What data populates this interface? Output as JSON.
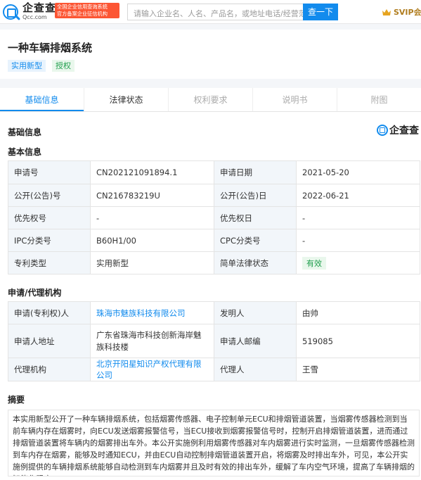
{
  "header": {
    "logo_cn": "企查查",
    "logo_en": "Qcc.com",
    "tagline_line1": "全国企业信用查询系统",
    "tagline_line2": "官方备案企业征信机构",
    "search_placeholder": "请输入企业名、人名、产品名，或地址电话/经营范",
    "search_button": "查一下",
    "svip_label": "SVIP会员"
  },
  "patent": {
    "title": "一种车辆排烟系统",
    "tags": [
      "实用新型",
      "授权"
    ]
  },
  "tabs": [
    "基础信息",
    "法律状态",
    "权利要求",
    "说明书",
    "附图"
  ],
  "section_title": "基础信息",
  "brand_logo_text": "企查查",
  "basic_info": {
    "subtitle": "基本信息",
    "rows": [
      {
        "l1": "申请号",
        "v1": "CN202121091894.1",
        "l2": "申请日期",
        "v2": "2021-05-20"
      },
      {
        "l1": "公开(公告)号",
        "v1": "CN216783219U",
        "l2": "公开(公告)日",
        "v2": "2022-06-21"
      },
      {
        "l1": "优先权号",
        "v1": "-",
        "l2": "优先权日",
        "v2": "-"
      },
      {
        "l1": "IPC分类号",
        "v1": "B60H1/00",
        "l2": "CPC分类号",
        "v2": "-"
      },
      {
        "l1": "专利类型",
        "v1": "实用新型",
        "l2": "简单法律状态",
        "v2": "有效"
      }
    ]
  },
  "agency": {
    "subtitle": "申请/代理机构",
    "rows": [
      {
        "l1": "申请(专利权)人",
        "v1": "珠海市魅族科技有限公司",
        "l2": "发明人",
        "v2": "由帅"
      },
      {
        "l1": "申请人地址",
        "v1": "广东省珠海市科技创新海岸魅族科技楼",
        "l2": "申请人邮编",
        "v2": "519085"
      },
      {
        "l1": "代理机构",
        "v1": "北京开阳星知识产权代理有限公司",
        "l2": "代理人",
        "v2": "王雪"
      }
    ]
  },
  "abstract": {
    "subtitle": "摘要",
    "text": "本实用新型公开了一种车辆排烟系统，包括烟雾传感器、电子控制单元ECU和排烟管道装置，当烟雾传感器检测到当前车辆内存在烟雾时，向ECU发送烟雾报警信号，当ECU接收到烟雾报警信号时，控制开启排烟管道装置，进而通过排烟管道装置将车辆内的烟雾排出车外。本公开实施例利用烟雾传感器对车内烟雾进行实时监测，一旦烟雾传感器检测到车内存在烟雾，能够及时通知ECU，并由ECU自动控制排烟管道装置开启，将烟雾及时排出车外，可见，本公开实施例提供的车辆排烟系统能够自动检测到车内烟雾并且及时有效的排出车外，缓解了车内空气环境，提高了车辆排烟的智能化程度。"
  },
  "colors": {
    "accent": "#128bed",
    "tagline_bg": "#fc5533",
    "status_green": "#1e9e4b",
    "label_bg": "#f2f6fa"
  }
}
